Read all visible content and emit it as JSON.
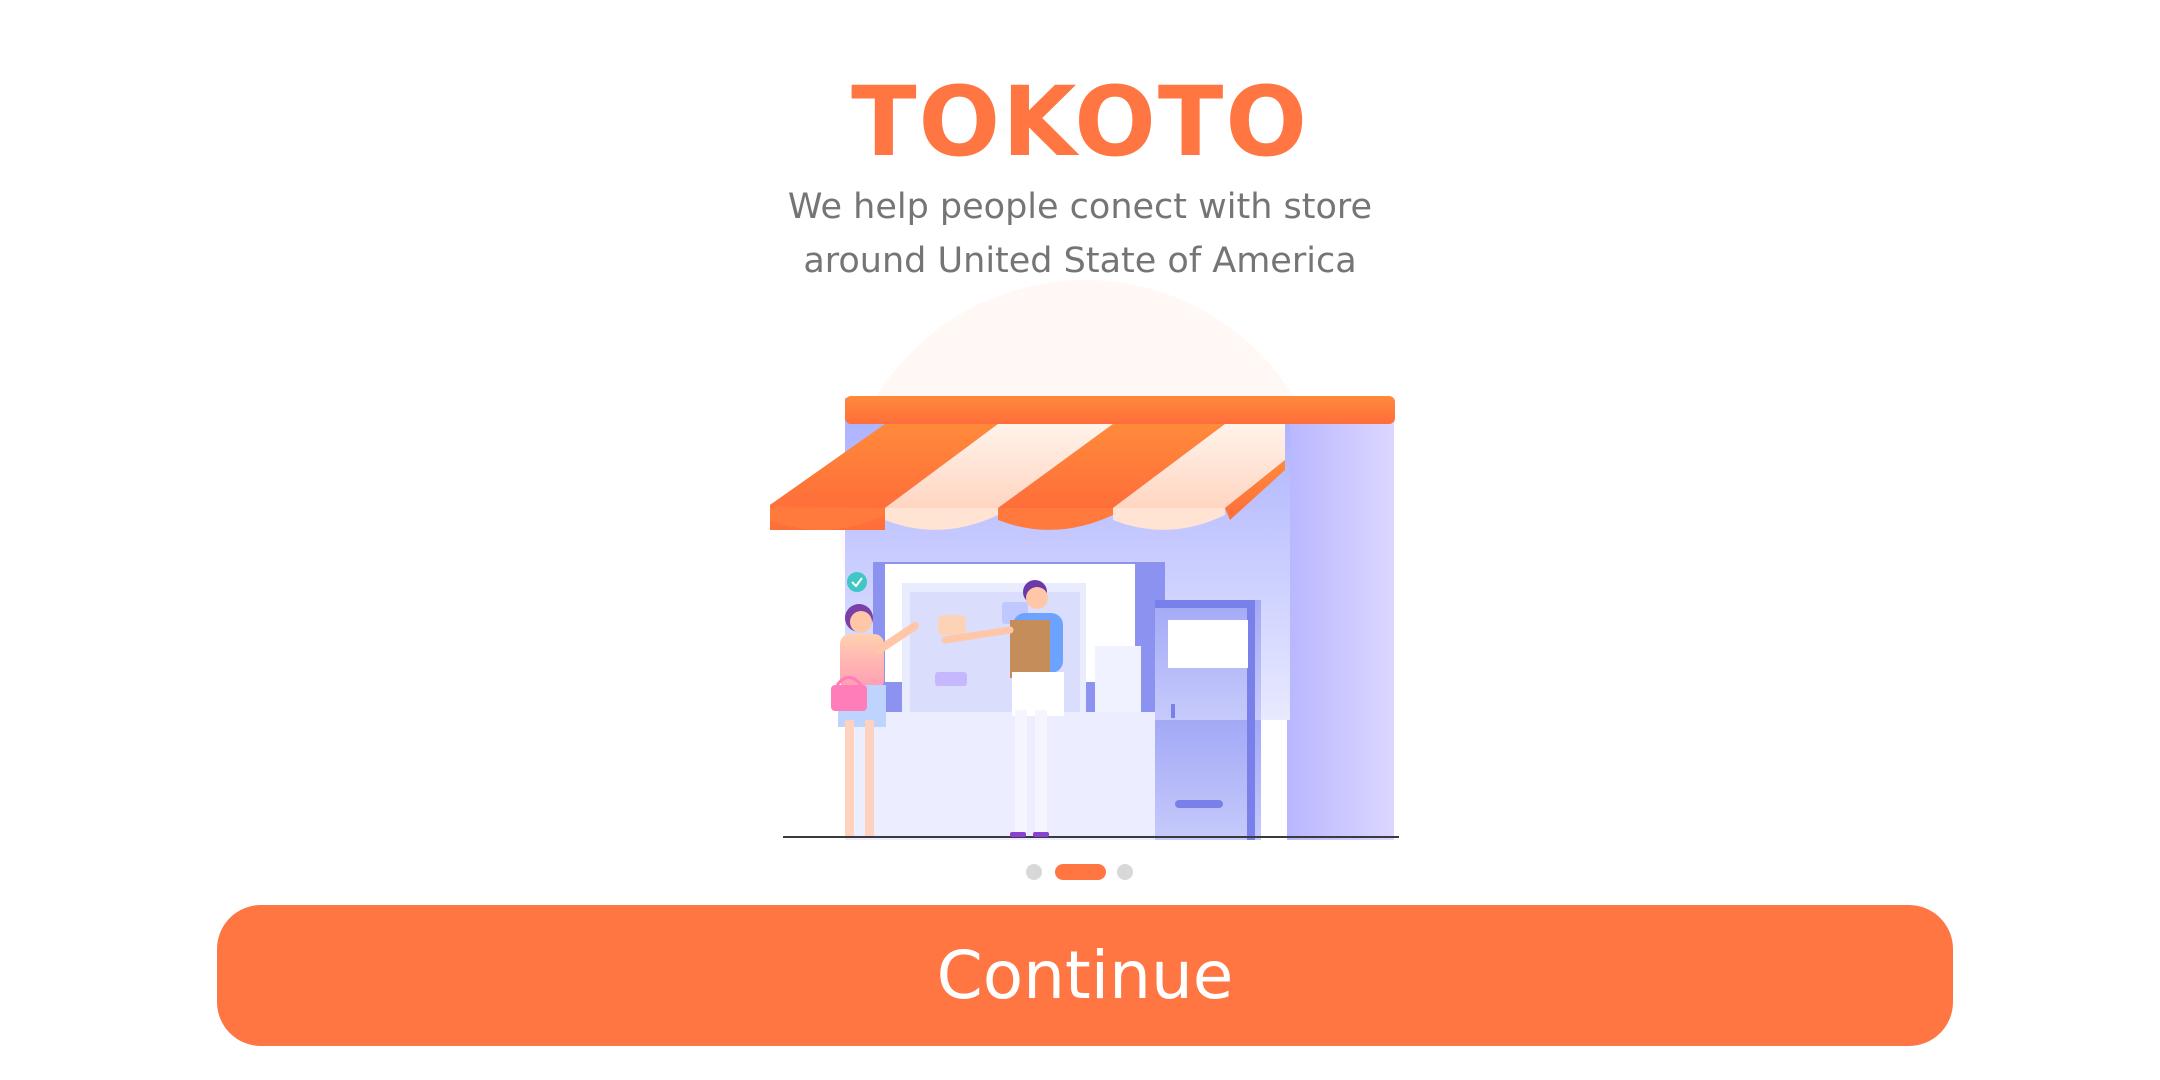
{
  "app": {
    "title": "TOKOTO"
  },
  "splash": {
    "subtitle_line1": "We help people conect with store",
    "subtitle_line2": "around United State of America",
    "illustration_icon": "storefront-illustration",
    "page_indicator": {
      "total": 3,
      "current": 2
    }
  },
  "actions": {
    "continue_label": "Continue"
  },
  "colors": {
    "primary": "#FF7643",
    "text_secondary": "#757575",
    "dot_inactive": "#D8D8D8",
    "background": "#FFFFFF"
  }
}
